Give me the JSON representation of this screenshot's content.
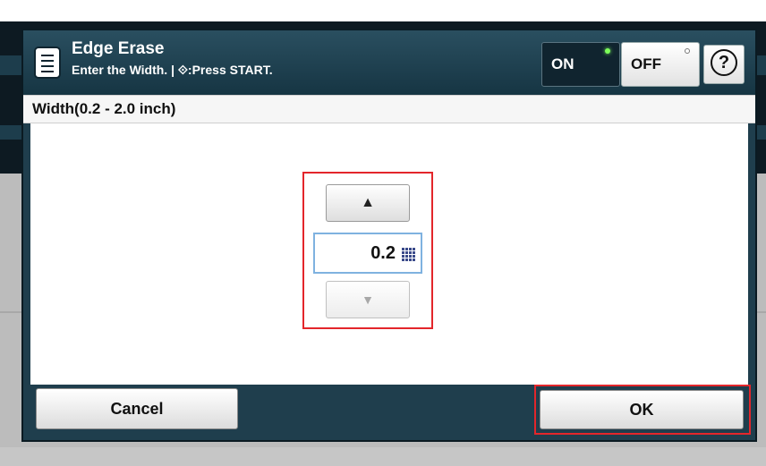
{
  "header": {
    "title": "Edge Erase",
    "subtitle": "Enter the Width. | ⟐:Press START.",
    "icon": "document-icon"
  },
  "toggle": {
    "on_label": "ON",
    "off_label": "OFF",
    "state": "on"
  },
  "help": {
    "label": "?"
  },
  "field_label": "Width(0.2 - 2.0 inch)",
  "spinner": {
    "up_symbol": "▲",
    "down_symbol": "▼",
    "value": "0.2",
    "min": 0.2,
    "max": 2.0,
    "unit": "inch"
  },
  "footer": {
    "cancel_label": "Cancel",
    "ok_label": "OK"
  },
  "colors": {
    "highlight": "#e3262b",
    "header": "#1f3e4d",
    "led_on": "#7dff5a"
  }
}
